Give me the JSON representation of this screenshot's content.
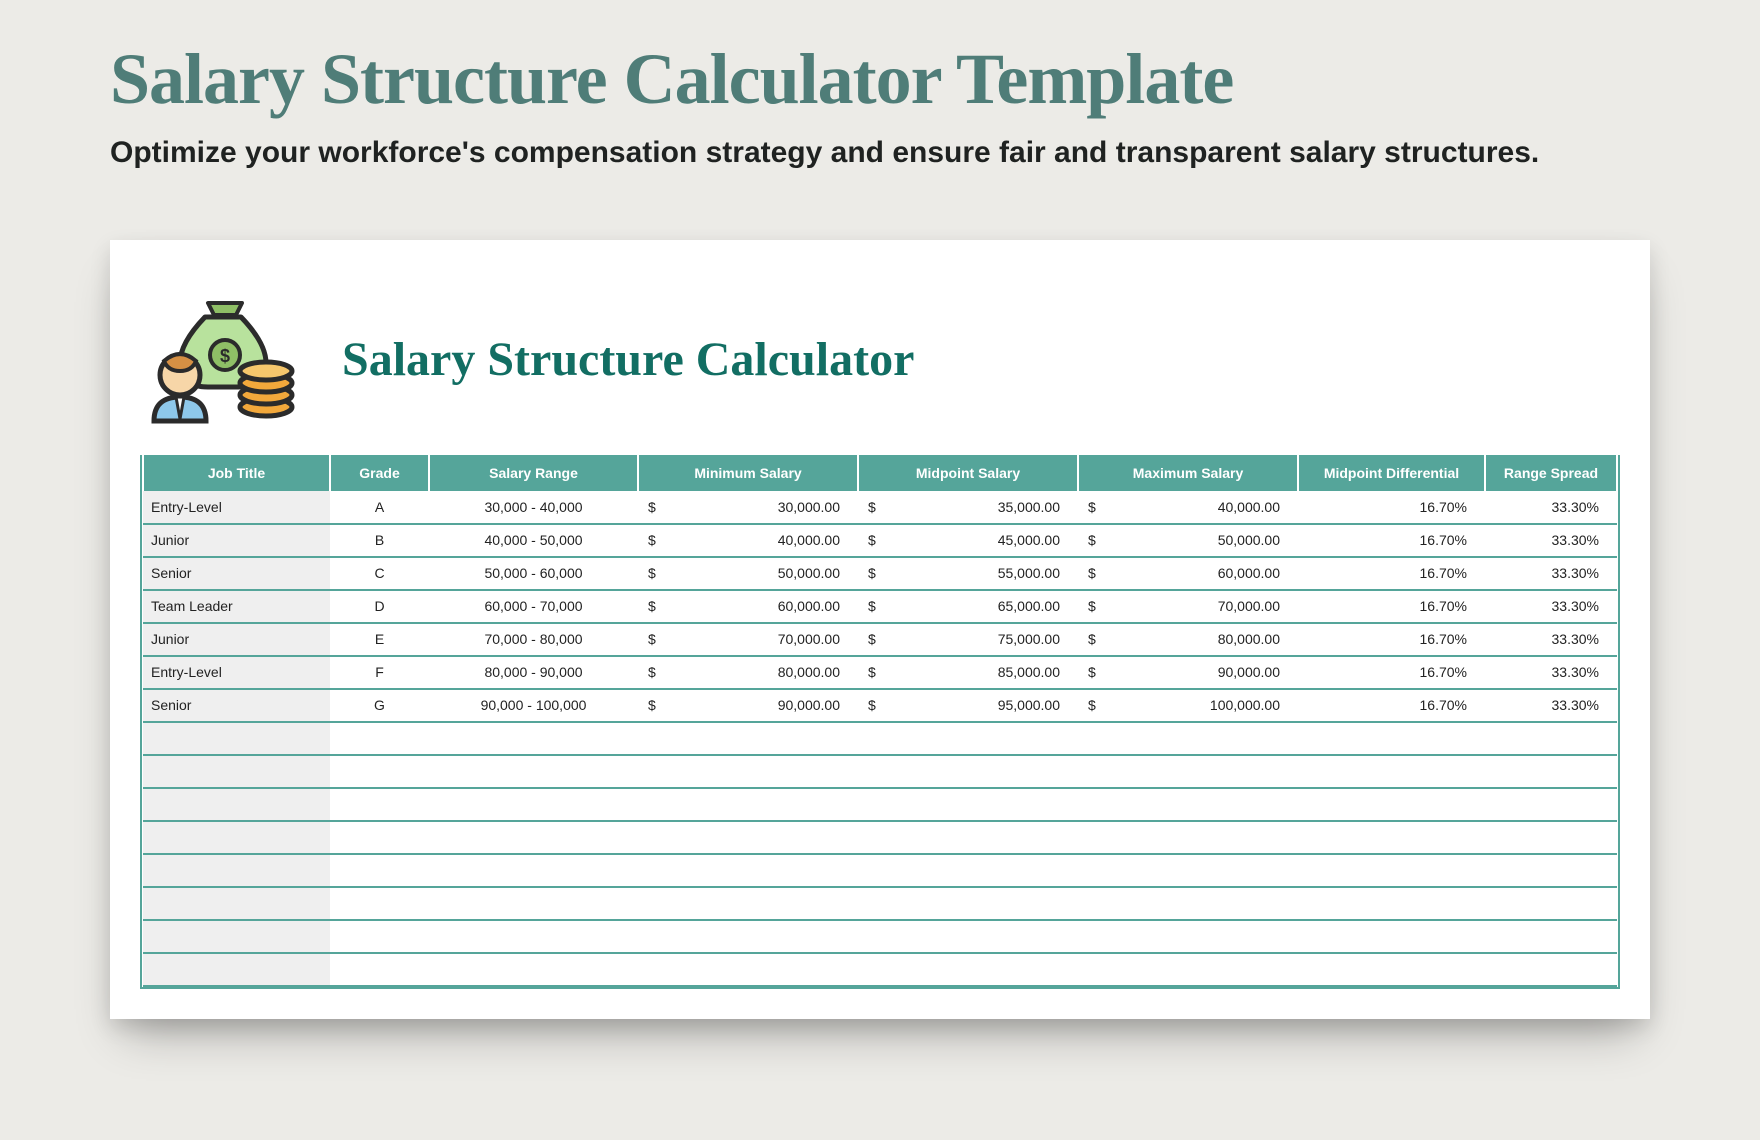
{
  "header": {
    "title": "Salary Structure Calculator Template",
    "subtitle": "Optimize your workforce's compensation strategy and ensure fair and transparent salary structures."
  },
  "card": {
    "title": "Salary Structure Calculator"
  },
  "table": {
    "columns": [
      "Job Title",
      "Grade",
      "Salary Range",
      "Minimum Salary",
      "Midpoint Salary",
      "Maximum Salary",
      "Midpoint Differential",
      "Range Spread"
    ],
    "currency": "$",
    "rows": [
      {
        "job": "Entry-Level",
        "grade": "A",
        "range": "30,000 - 40,000",
        "min": "30,000.00",
        "mid": "35,000.00",
        "max": "40,000.00",
        "diff": "16.70%",
        "spread": "33.30%"
      },
      {
        "job": "Junior",
        "grade": "B",
        "range": "40,000 - 50,000",
        "min": "40,000.00",
        "mid": "45,000.00",
        "max": "50,000.00",
        "diff": "16.70%",
        "spread": "33.30%"
      },
      {
        "job": "Senior",
        "grade": "C",
        "range": "50,000 - 60,000",
        "min": "50,000.00",
        "mid": "55,000.00",
        "max": "60,000.00",
        "diff": "16.70%",
        "spread": "33.30%"
      },
      {
        "job": "Team Leader",
        "grade": "D",
        "range": "60,000 - 70,000",
        "min": "60,000.00",
        "mid": "65,000.00",
        "max": "70,000.00",
        "diff": "16.70%",
        "spread": "33.30%"
      },
      {
        "job": "Junior",
        "grade": "E",
        "range": "70,000 - 80,000",
        "min": "70,000.00",
        "mid": "75,000.00",
        "max": "80,000.00",
        "diff": "16.70%",
        "spread": "33.30%"
      },
      {
        "job": "Entry-Level",
        "grade": "F",
        "range": "80,000 - 90,000",
        "min": "80,000.00",
        "mid": "85,000.00",
        "max": "90,000.00",
        "diff": "16.70%",
        "spread": "33.30%"
      },
      {
        "job": "Senior",
        "grade": "G",
        "range": "90,000 - 100,000",
        "min": "90,000.00",
        "mid": "95,000.00",
        "max": "100,000.00",
        "diff": "16.70%",
        "spread": "33.30%"
      }
    ],
    "empty_rows": 8
  }
}
